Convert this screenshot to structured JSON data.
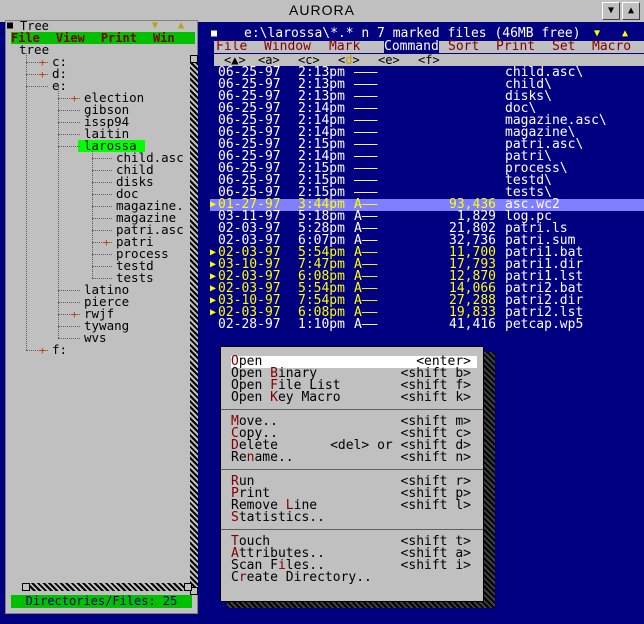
{
  "window": {
    "title": "AURORA",
    "minimize_icon": "triangle-down",
    "maximize_icon": "triangle-up"
  },
  "tree": {
    "title": "Tree",
    "menu": [
      "File",
      "View",
      "Print",
      "Win"
    ],
    "root": "tree",
    "items": [
      {
        "label": "c:",
        "level": 1,
        "expandable": true
      },
      {
        "label": "d:",
        "level": 1,
        "expandable": true
      },
      {
        "label": "e:",
        "level": 1,
        "expandable": false
      },
      {
        "label": "election",
        "level": 2,
        "expandable": true
      },
      {
        "label": "gibson",
        "level": 2,
        "expandable": false
      },
      {
        "label": "issp94",
        "level": 2,
        "expandable": false
      },
      {
        "label": "laitin",
        "level": 2,
        "expandable": false
      },
      {
        "label": "larossa",
        "level": 2,
        "expandable": false,
        "selected": true
      },
      {
        "label": "child.asc",
        "level": 3,
        "expandable": false
      },
      {
        "label": "child",
        "level": 3,
        "expandable": false
      },
      {
        "label": "disks",
        "level": 3,
        "expandable": false
      },
      {
        "label": "doc",
        "level": 3,
        "expandable": false
      },
      {
        "label": "magazine.",
        "level": 3,
        "expandable": false
      },
      {
        "label": "magazine",
        "level": 3,
        "expandable": false
      },
      {
        "label": "patri.asc",
        "level": 3,
        "expandable": false
      },
      {
        "label": "patri",
        "level": 3,
        "expandable": true
      },
      {
        "label": "process",
        "level": 3,
        "expandable": false
      },
      {
        "label": "testd",
        "level": 3,
        "expandable": false
      },
      {
        "label": "tests",
        "level": 3,
        "expandable": false
      },
      {
        "label": "latino",
        "level": 2,
        "expandable": false
      },
      {
        "label": "pierce",
        "level": 2,
        "expandable": false
      },
      {
        "label": "rwjf",
        "level": 2,
        "expandable": true
      },
      {
        "label": "tywang",
        "level": 2,
        "expandable": false
      },
      {
        "label": "wvs",
        "level": 2,
        "expandable": false
      },
      {
        "label": "f:",
        "level": 1,
        "expandable": true
      }
    ],
    "status": "Directories/Files: 25"
  },
  "files": {
    "path": "e:\\larossa\\*.* n 7 marked files (46MB free)",
    "menu": [
      "File",
      "Window",
      "Mark",
      "Command",
      "Sort",
      "Print",
      "Set",
      "Macro"
    ],
    "menu_selected": "Command",
    "sort_keys": [
      "a",
      "c",
      "d",
      "e",
      "f"
    ],
    "rows": [
      {
        "mark": "",
        "date": "06-25-97",
        "time": "2:13pm",
        "attr": "———",
        "size": "",
        "name": "child.asc\\"
      },
      {
        "mark": "",
        "date": "06-25-97",
        "time": "2:13pm",
        "attr": "———",
        "size": "",
        "name": "child\\"
      },
      {
        "mark": "",
        "date": "06-25-97",
        "time": "2:13pm",
        "attr": "———",
        "size": "",
        "name": "disks\\"
      },
      {
        "mark": "",
        "date": "06-25-97",
        "time": "2:14pm",
        "attr": "———",
        "size": "",
        "name": "doc\\"
      },
      {
        "mark": "",
        "date": "06-25-97",
        "time": "2:14pm",
        "attr": "———",
        "size": "",
        "name": "magazine.asc\\"
      },
      {
        "mark": "",
        "date": "06-25-97",
        "time": "2:14pm",
        "attr": "———",
        "size": "",
        "name": "magazine\\"
      },
      {
        "mark": "",
        "date": "06-25-97",
        "time": "2:15pm",
        "attr": "———",
        "size": "",
        "name": "patri.asc\\"
      },
      {
        "mark": "",
        "date": "06-25-97",
        "time": "2:14pm",
        "attr": "———",
        "size": "",
        "name": "patri\\"
      },
      {
        "mark": "",
        "date": "06-25-97",
        "time": "2:15pm",
        "attr": "———",
        "size": "",
        "name": "process\\"
      },
      {
        "mark": "",
        "date": "06-25-97",
        "time": "2:15pm",
        "attr": "———",
        "size": "",
        "name": "testd\\"
      },
      {
        "mark": "",
        "date": "06-25-97",
        "time": "2:15pm",
        "attr": "———",
        "size": "",
        "name": "tests\\"
      },
      {
        "mark": "▶",
        "date": "01-27-97",
        "time": "3:44pm",
        "attr": "A——",
        "size": "93,436",
        "name": "asc.wc2",
        "current": true
      },
      {
        "mark": "",
        "date": "03-11-97",
        "time": "5:18pm",
        "attr": "A——",
        "size": "1,829",
        "name": "log.pc"
      },
      {
        "mark": "",
        "date": "02-03-97",
        "time": "5:28pm",
        "attr": "A——",
        "size": "21,802",
        "name": "patri.ls"
      },
      {
        "mark": "",
        "date": "02-03-97",
        "time": "6:07pm",
        "attr": "A——",
        "size": "32,736",
        "name": "patri.sum"
      },
      {
        "mark": "▶",
        "date": "02-03-97",
        "time": "5:54pm",
        "attr": "A——",
        "size": "11,700",
        "name": "patri1.bat"
      },
      {
        "mark": "▶",
        "date": "03-10-97",
        "time": "7:47pm",
        "attr": "A——",
        "size": "17,793",
        "name": "patri1.dir"
      },
      {
        "mark": "▶",
        "date": "02-03-97",
        "time": "6:08pm",
        "attr": "A——",
        "size": "12,870",
        "name": "patri1.lst"
      },
      {
        "mark": "▶",
        "date": "02-03-97",
        "time": "5:54pm",
        "attr": "A——",
        "size": "14,066",
        "name": "patri2.bat"
      },
      {
        "mark": "▶",
        "date": "03-10-97",
        "time": "7:54pm",
        "attr": "A——",
        "size": "27,288",
        "name": "patri2.dir"
      },
      {
        "mark": "▶",
        "date": "02-03-97",
        "time": "6:08pm",
        "attr": "A——",
        "size": "19,833",
        "name": "patri2.lst"
      },
      {
        "mark": "",
        "date": "02-28-97",
        "time": "1:10pm",
        "attr": "A——",
        "size": "41,416",
        "name": "petcap.wp5"
      }
    ]
  },
  "popup": {
    "groups": [
      [
        {
          "label": "Open",
          "hot": "O",
          "shortcut": "<enter>",
          "selected": true
        },
        {
          "label": "Open Binary",
          "hot": "B",
          "shortcut": "<shift b>"
        },
        {
          "label": "Open File List",
          "hot": "F",
          "shortcut": "<shift f>"
        },
        {
          "label": "Open Key Macro",
          "hot": "K",
          "shortcut": "<shift k>"
        }
      ],
      [
        {
          "label": "Move..",
          "hot": "M",
          "shortcut": "<shift m>"
        },
        {
          "label": "Copy..",
          "hot": "C",
          "shortcut": "<shift c>"
        },
        {
          "label": "Delete",
          "hot": "D",
          "shortcut": "<del> or <shift d>"
        },
        {
          "label": "Rename..",
          "hot": "n",
          "shortcut": "<shift n>"
        }
      ],
      [
        {
          "label": "Run",
          "hot": "R",
          "shortcut": "<shift r>"
        },
        {
          "label": "Print",
          "hot": "P",
          "shortcut": "<shift p>"
        },
        {
          "label": "Remove Line",
          "hot": "L",
          "shortcut": "<shift l>"
        },
        {
          "label": "Statistics..",
          "hot": "S",
          "shortcut": ""
        }
      ],
      [
        {
          "label": "Touch",
          "hot": "T",
          "shortcut": "<shift t>"
        },
        {
          "label": "Attributes..",
          "hot": "A",
          "shortcut": "<shift a>"
        },
        {
          "label": "Scan Files..",
          "hot": "i",
          "shortcut": "<shift i>"
        },
        {
          "label": "Create Directory..",
          "hot": "r",
          "shortcut": ""
        }
      ]
    ]
  },
  "colors": {
    "tree_bg": "#c0c0c0",
    "accent_green": "#00c000",
    "files_bg": "#000080",
    "marked": "#ffff00",
    "current_row": "#8080ff",
    "hotkey": "#800000"
  }
}
